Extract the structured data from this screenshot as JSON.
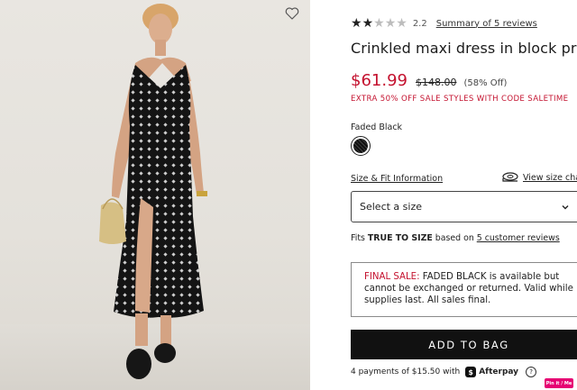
{
  "product": {
    "rating_value": "2.2",
    "stars_filled": 2,
    "stars_total": 5,
    "reviews_link": "Summary of 5 reviews",
    "title": "Crinkled maxi dress in block print",
    "price_sale": "$61.99",
    "price_original": "$148.00",
    "discount": "(58% Off)",
    "promo": "EXTRA 50% OFF SALE STYLES WITH CODE SALETIME",
    "color_label": "Faded Black",
    "size_fit_link": "Size & Fit Information",
    "size_chart_link": "View size chart",
    "size_select_placeholder": "Select a size",
    "fit_note_prefix": "Fits ",
    "fit_note_bold": "TRUE TO SIZE",
    "fit_note_mid": " based on ",
    "fit_note_link": "5 customer reviews",
    "final_sale_label": "FINAL SALE:",
    "final_sale_text": " FADED BLACK is available but cannot be exchanged or returned. Valid while supplies last. All sales final.",
    "add_to_bag": "ADD TO BAG",
    "afterpay_text": "4 payments of $15.50 with",
    "afterpay_brand": "Afterpay",
    "help_glyph": "?"
  },
  "overlay": {
    "pin_label": "Pin it / Me"
  },
  "icons": {
    "wishlist": "heart-outline-icon",
    "size_chart": "tape-measure-icon",
    "dropdown": "chevron-down-icon",
    "afterpay": "afterpay-logo-icon"
  },
  "colors": {
    "sale_red": "#c4122f",
    "button_black": "#111111",
    "pin_pink": "#e60073"
  }
}
